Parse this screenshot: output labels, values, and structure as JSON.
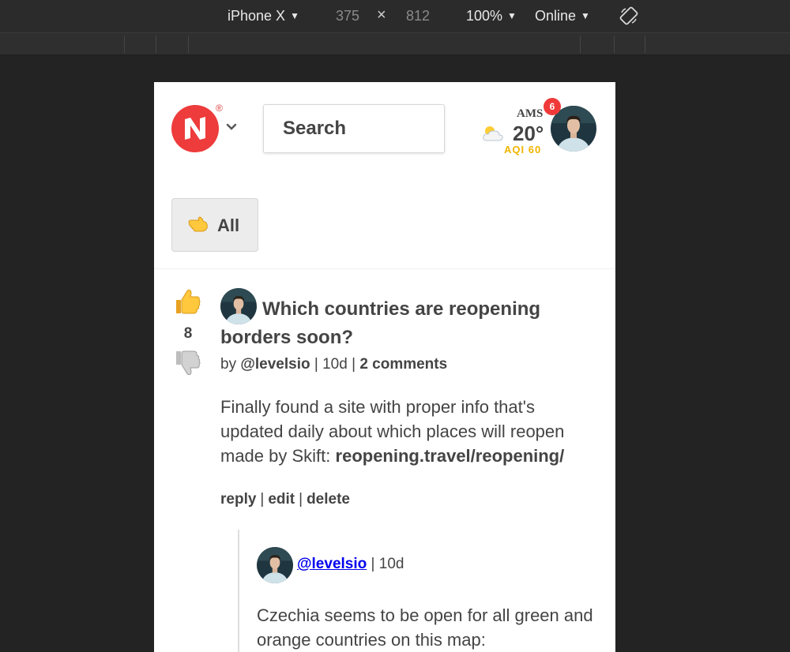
{
  "devtools": {
    "device": "iPhone X",
    "width": "375",
    "x_sign": "×",
    "height": "812",
    "zoom": "100%",
    "network": "Online",
    "caret": "▼",
    "rotate_icon": "rotate-icon"
  },
  "header": {
    "logo_icon": "nomad-list-logo",
    "logo_registered": "®",
    "search_placeholder": "Search",
    "weather": {
      "icon": "partly-cloudy-icon",
      "city": "AMS",
      "temperature": "20°",
      "aqi": "AQI 60"
    },
    "notification_count": "6"
  },
  "filter": {
    "icon": "pointing-hand-icon",
    "label": "All"
  },
  "post": {
    "votes": "8",
    "title": "Which countries are reopening borders soon?",
    "by_prefix": "by",
    "author": "@levelsio",
    "sep": "|",
    "age": "10d",
    "comments": "2 comments",
    "body_text": "Finally found a site with proper info that's updated daily about which places will reopen made by Skift: ",
    "body_link": "reopening.travel/reopening/",
    "actions": {
      "reply": "reply",
      "edit": "edit",
      "delete": "delete"
    }
  },
  "reply": {
    "author": "@levelsio",
    "age": "10d",
    "body": "Czechia seems to be open for all green and orange countries on this map:"
  },
  "colors": {
    "brand_red": "#ee3b3b",
    "badge_red": "#f03a3a",
    "aqi_yellow": "#f0b400",
    "text": "#444444",
    "devtools_bg": "#232323"
  }
}
